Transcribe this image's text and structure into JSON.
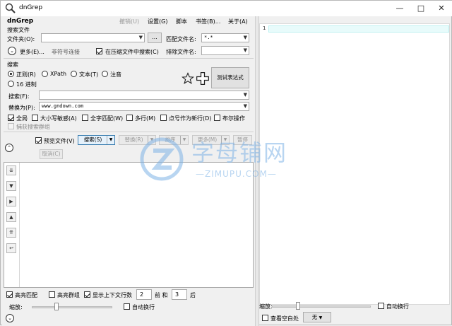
{
  "app": {
    "title": "dnGrep",
    "heading": "dnGrep"
  },
  "window_controls": {
    "minimize": "—",
    "maximize": "□",
    "close": "✕"
  },
  "menu": {
    "undo": "撤销(U)",
    "settings": "设置(G)",
    "script": "脚本",
    "bookmarks": "书签(B)...",
    "about": "关于(A)"
  },
  "search_files": {
    "section_title": "搜索文件",
    "folder_label": "文件夹(O):",
    "folder_value": "",
    "browse_button": "...",
    "pattern_label": "匹配文件名:",
    "pattern_value": "*.*",
    "more_label": "更多(E)...",
    "nonsym_label": "非符号连接",
    "search_archives_label": "在压缩文件中搜索(C)",
    "search_archives_checked": true,
    "exclude_label": "排除文件名:",
    "exclude_value": ""
  },
  "search": {
    "section_title": "搜索",
    "modes": [
      "正则(R)",
      "XPath",
      "文本(T)",
      "注音",
      "16 进制"
    ],
    "selected_mode": "正则(R)",
    "test_regex_button": "测试表达式",
    "search_label": "搜索(F):",
    "search_value": "",
    "replace_label": "替换为(P):",
    "replace_value": "www.gndown.com",
    "options": [
      {
        "label": "全局",
        "checked": true
      },
      {
        "label": "大小写敏感(A)",
        "checked": false
      },
      {
        "label": "全字匹配(W)",
        "checked": false
      },
      {
        "label": "多行(M)",
        "checked": false
      },
      {
        "label": "点号作为新行(D)",
        "checked": false
      },
      {
        "label": "布尔操作",
        "checked": false
      }
    ],
    "capture_groups_label": "捕获搜索群组"
  },
  "actions": {
    "preview_label": "预览文件(V)",
    "preview_checked": true,
    "search_button": "搜索(S)",
    "replace_button": "替换(R)",
    "sort_button": "排序",
    "more_button": "更多(M)",
    "pause_button": "暂停",
    "cancel_button": "取消(C)"
  },
  "results_toolbar": [
    "⇊",
    "▼",
    "▶",
    "▲",
    "⇈",
    "↩"
  ],
  "bottom_left": {
    "highlight_matches": "高亮匹配",
    "highlight_matches_checked": true,
    "highlight_groups": "高亮群组",
    "highlight_groups_checked": false,
    "show_context": "显示上下文行数",
    "show_context_checked": true,
    "before_value": "2",
    "before_label": "前 和",
    "after_value": "3",
    "after_label": "后",
    "zoom_label": "缩放:",
    "zoom_level": 0.3,
    "word_wrap_label": "自动换行",
    "word_wrap_checked": false
  },
  "preview": {
    "line_numbers": [
      "1"
    ],
    "zoom_label": "缩放:",
    "zoom_level": 0.25,
    "word_wrap_label": "自动换行",
    "word_wrap_checked": false,
    "show_whitespace_label": "查看空白处",
    "show_whitespace_checked": false,
    "syntax_value": "无"
  },
  "watermark": {
    "big": "字母铺网",
    "small": "—ZIMUPU.COM—"
  },
  "colors": {
    "editor_current_line": "#e8fbfb",
    "watermark": "#7fb3e6"
  }
}
